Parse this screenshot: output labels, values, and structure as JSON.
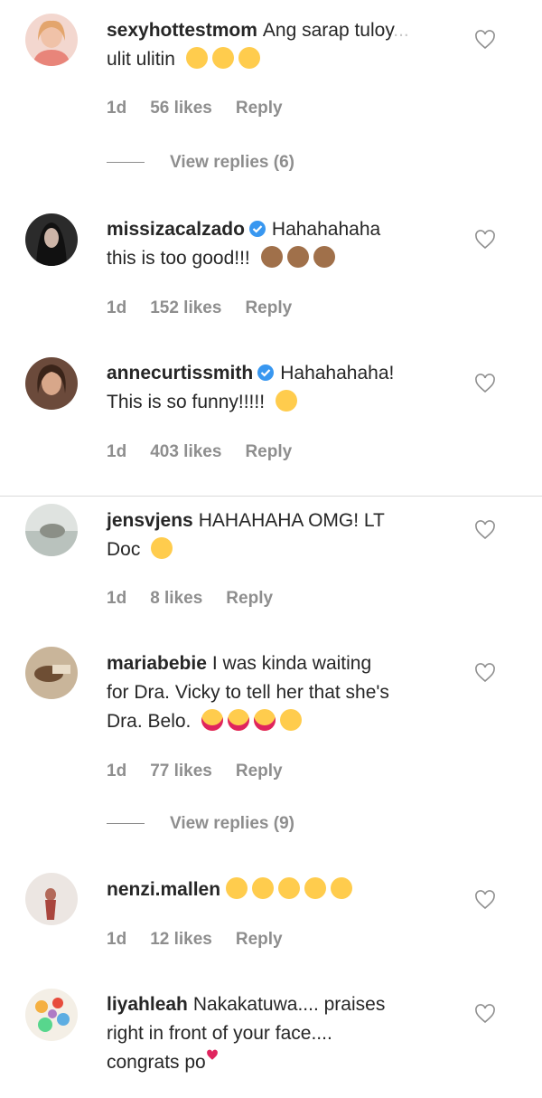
{
  "comments": [
    {
      "username": "sexyhottestmom",
      "text": "Ang sarap tuloy",
      "text_faded": "...",
      "line2": "ulit ulitin",
      "emojis": [
        "rofl",
        "rofl",
        "rofl"
      ],
      "verified": false,
      "age": "1d",
      "likes": "56 likes",
      "reply": "Reply",
      "view_replies": "View replies (6)"
    },
    {
      "username": "missizacalzado",
      "text": "Hahahahaha",
      "line2": "this is too good!!!",
      "emojis": [
        "clap",
        "clap",
        "clap"
      ],
      "verified": true,
      "age": "1d",
      "likes": "152 likes",
      "reply": "Reply"
    },
    {
      "username": "annecurtissmith",
      "text": "Hahahahaha!",
      "line2": "This is so funny!!!!!",
      "emojis": [
        "joy"
      ],
      "verified": true,
      "age": "1d",
      "likes": "403 likes",
      "reply": "Reply"
    },
    {
      "username": "jensvjens",
      "text": "HAHAHAHA OMG! LT",
      "line2": "Doc",
      "emojis": [
        "joy"
      ],
      "verified": false,
      "age": "1d",
      "likes": "8 likes",
      "reply": "Reply"
    },
    {
      "username": "mariabebie",
      "text": "I was kinda waiting",
      "line2": "for Dra. Vicky to tell her that she's",
      "line3": "Dra. Belo.",
      "emojis": [
        "heart_eyes",
        "heart_eyes",
        "heart_eyes",
        "tongue"
      ],
      "verified": false,
      "age": "1d",
      "likes": "77 likes",
      "reply": "Reply",
      "view_replies": "View replies (9)"
    },
    {
      "username": "nenzi.mallen",
      "text": "",
      "emojis": [
        "joy",
        "joy",
        "joy",
        "joy",
        "joy"
      ],
      "verified": false,
      "age": "1d",
      "likes": "12 likes",
      "reply": "Reply"
    },
    {
      "username": "liyahleah",
      "text": "Nakakatuwa.... praises",
      "line2": "right in front of your face....",
      "line3": "congrats po",
      "emojis": [
        "red-heart"
      ],
      "verified": false
    }
  ],
  "icons": {
    "like": "heart-outline-icon",
    "verified": "verified-badge-icon"
  },
  "colors": {
    "text": "#262626",
    "muted": "#8e8e8e",
    "verified": "#3897f0",
    "emoji_yellow": "#ffcc4d",
    "clap": "#a0704a",
    "heart": "#e0245e"
  }
}
